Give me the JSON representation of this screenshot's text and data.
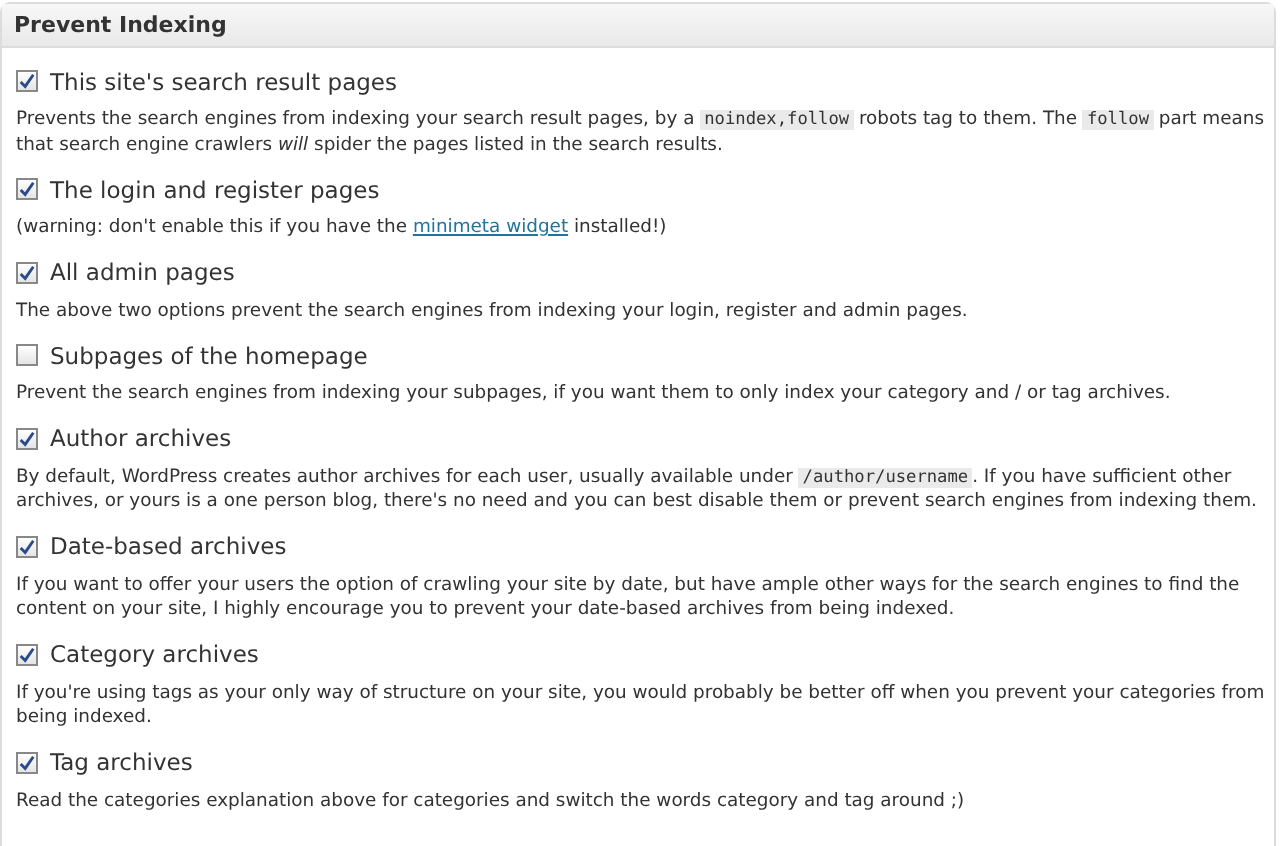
{
  "panel": {
    "title": "Prevent Indexing"
  },
  "options": [
    {
      "label": "This site's search result pages",
      "checked": true,
      "description": [
        {
          "kind": "text",
          "text": "Prevents the search engines from indexing your search result pages, by a "
        },
        {
          "kind": "code",
          "text": "noindex,follow"
        },
        {
          "kind": "text",
          "text": " robots tag to them. The "
        },
        {
          "kind": "code",
          "text": "follow"
        },
        {
          "kind": "text",
          "text": " part means that search engine crawlers *will* spider the pages listed in the search results."
        }
      ]
    },
    {
      "label": "The login and register pages",
      "checked": true,
      "description": [
        {
          "kind": "text",
          "text": "(warning: don't enable this if you have the "
        },
        {
          "kind": "link",
          "text": "minimeta widget"
        },
        {
          "kind": "text",
          "text": " installed!)"
        }
      ]
    },
    {
      "label": "All admin pages",
      "checked": true,
      "description": [
        {
          "kind": "text",
          "text": "The above two options prevent the search engines from indexing your login, register and admin pages."
        }
      ]
    },
    {
      "label": "Subpages of the homepage",
      "checked": false,
      "description": [
        {
          "kind": "text",
          "text": "Prevent the search engines from indexing your subpages, if you want them to only index your category and / or tag archives."
        }
      ]
    },
    {
      "label": "Author archives",
      "checked": true,
      "description": [
        {
          "kind": "text",
          "text": "By default, WordPress creates author archives for each user, usually available under "
        },
        {
          "kind": "code",
          "text": "/author/username"
        },
        {
          "kind": "text",
          "text": ". If you have sufficient other archives, or yours is a one person blog, there's no need and you can best disable them or prevent search engines from indexing them."
        }
      ]
    },
    {
      "label": "Date-based archives",
      "checked": true,
      "description": [
        {
          "kind": "text",
          "text": "If you want to offer your users the option of crawling your site by date, but have ample other ways for the search engines to find the content on your site, I highly encourage you to prevent your date-based archives from being indexed."
        }
      ]
    },
    {
      "label": "Category archives",
      "checked": true,
      "description": [
        {
          "kind": "text",
          "text": "If you're using tags as your only way of structure on your site, you would probably be better off when you prevent your categories from being indexed."
        }
      ]
    },
    {
      "label": "Tag archives",
      "checked": true,
      "description": [
        {
          "kind": "text",
          "text": "Read the categories explanation above for categories and switch the words category and tag around ;)"
        }
      ]
    }
  ]
}
